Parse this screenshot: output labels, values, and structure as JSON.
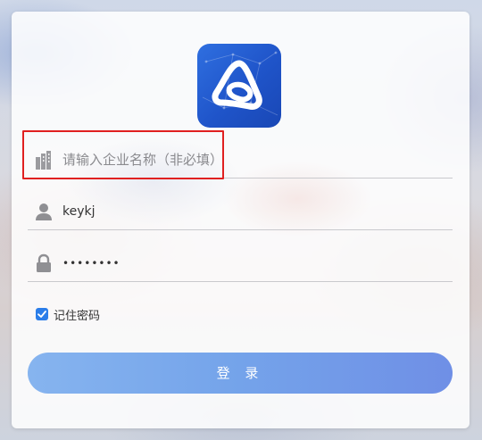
{
  "form": {
    "company_placeholder": "请输入企业名称（非必填）",
    "username_value": "keykj",
    "password_value": "••••••••",
    "remember_label": "记住密码",
    "remember_checked": true,
    "login_label": "登 录"
  },
  "icons": {
    "logo": "app-logo-icon",
    "company": "building-icon",
    "user": "user-icon",
    "password": "lock-icon",
    "checkbox": "checkmark-icon"
  },
  "colors": {
    "accent": "#2b7de9",
    "button_gradient_start": "#86b4ef",
    "button_gradient_end": "#6f8fe6",
    "highlight": "#e02020",
    "logo_blue": "#1f54c9"
  }
}
